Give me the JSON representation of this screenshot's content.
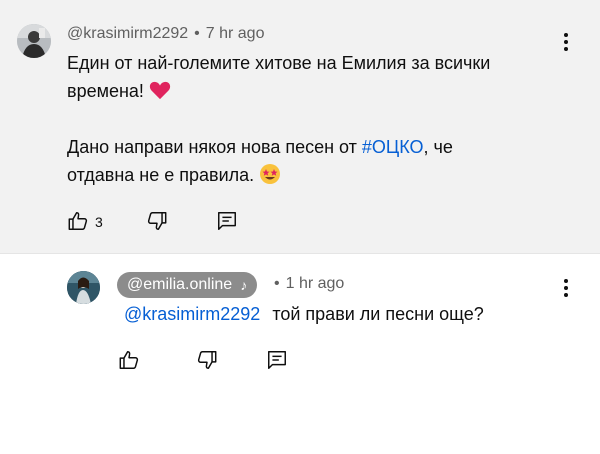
{
  "comment": {
    "author": "@krasimirm2292",
    "separator": "•",
    "time": "7 hr ago",
    "line1": "Един от най-големите хитове на Емилия за всички",
    "line2_text": "времена!",
    "line2_emoji": "❤️",
    "line3_prefix": "Дано направи някоя нова песен от ",
    "line3_hashtag": "#ОЦКО",
    "line3_suffix": ", че",
    "line4_text": "отдавна не е правила.",
    "line4_emoji": "🤩",
    "like_count": "3",
    "icons": [
      "like-icon",
      "dislike-icon",
      "reply-icon",
      "more-icon"
    ]
  },
  "reply": {
    "author": "@emilia.online",
    "author_badge_icon": "music-note-icon",
    "author_badge_glyph": "♪",
    "separator": "•",
    "time": "1 hr ago",
    "mention": "@krasimirm2292",
    "text": "той прави ли песни още?",
    "icons": [
      "like-icon",
      "dislike-icon",
      "reply-icon",
      "more-icon"
    ]
  },
  "colors": {
    "link": "#065fd4",
    "top_background": "#f2f2f2",
    "author_pill": "#8c8c8c",
    "heart": "#e0245e"
  }
}
